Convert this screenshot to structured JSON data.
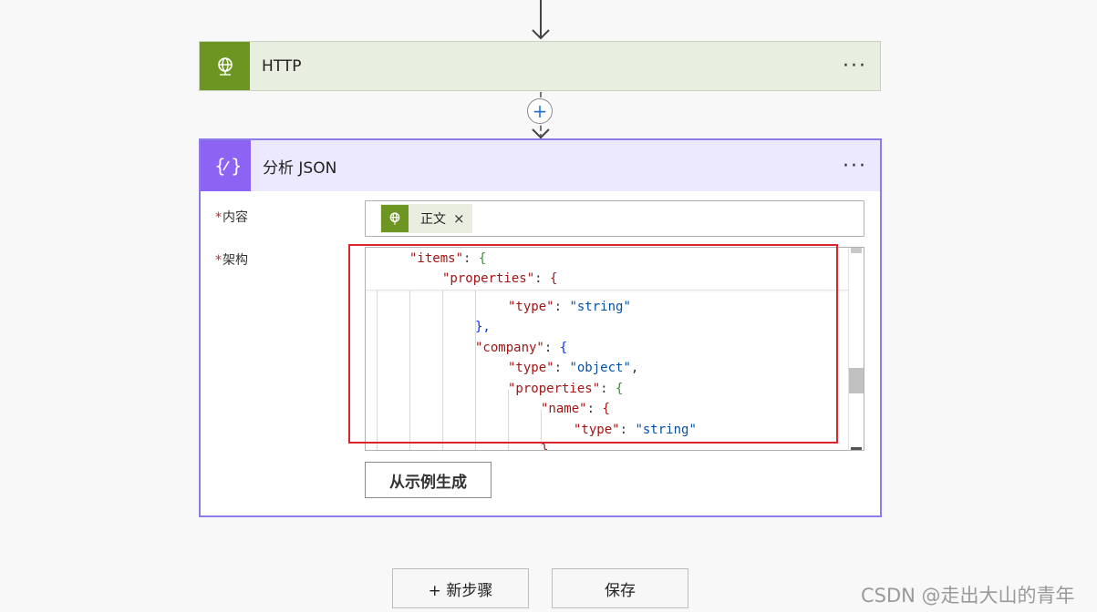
{
  "http_card": {
    "title": "HTTP",
    "more": "···",
    "icon": "globe-icon",
    "color": "#6d9522"
  },
  "connector": {
    "plus": "+"
  },
  "json_card": {
    "title": "分析 JSON",
    "more": "···",
    "icon": "curly-braces-icon",
    "color": "#8c63f2",
    "content_label": "内容",
    "schema_label": "架构",
    "required_mark": "*",
    "token": {
      "label": "正文",
      "close": "×",
      "icon": "globe-icon"
    },
    "generate_button": "从示例生成"
  },
  "editor": {
    "sticky_lines": [
      {
        "key": "\"items\"",
        "rest": ": ",
        "brace": "{"
      },
      {
        "key": "\"properties\"",
        "rest": ": ",
        "brace": "{"
      }
    ],
    "lines": [
      {
        "key": "\"type\"",
        "sep": ": ",
        "value": "\"string\""
      },
      {
        "close": "},",
        "closing": "},"
      },
      {
        "key": "\"company\"",
        "sep": ": ",
        "brace": "{"
      },
      {
        "key": "\"type\"",
        "sep": ": ",
        "value": "\"object\"",
        "trail": ","
      },
      {
        "key": "\"properties\"",
        "sep": ": ",
        "brace": "{"
      },
      {
        "key": "\"name\"",
        "sep": ": ",
        "brace": "{"
      },
      {
        "key": "\"type\"",
        "sep": ": ",
        "value": "\"string\""
      },
      {
        "closing": "}"
      }
    ]
  },
  "footer": {
    "new_step": "+ 新步骤",
    "save": "保存"
  },
  "watermark": "CSDN @走出大山的青年"
}
